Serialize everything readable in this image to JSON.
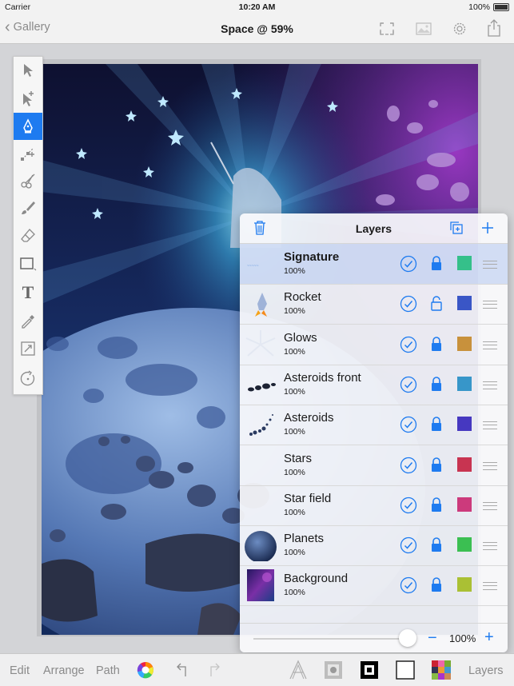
{
  "status": {
    "carrier": "Carrier",
    "time": "10:20 AM",
    "battery": "100%"
  },
  "nav": {
    "back_label": "Gallery",
    "title": "Space @ 59%",
    "icons": [
      "fullscreen-icon",
      "image-icon",
      "gear-icon",
      "share-icon"
    ]
  },
  "tools": [
    "select-arrow-icon",
    "direct-select-icon",
    "pen-icon",
    "node-icon",
    "scissors-icon",
    "brush-icon",
    "eraser-icon",
    "rectangle-icon",
    "text-icon",
    "eyedropper-icon",
    "transform-icon",
    "rotate-icon"
  ],
  "tools_active": "pen-icon",
  "tools_text_glyph": "T",
  "layers": {
    "title": "Layers",
    "items": [
      {
        "name": "Signature",
        "opacity": "100%",
        "locked": true,
        "color": "#35c08a",
        "selected": true
      },
      {
        "name": "Rocket",
        "opacity": "100%",
        "locked": false,
        "color": "#3a56c6",
        "selected": false
      },
      {
        "name": "Glows",
        "opacity": "100%",
        "locked": true,
        "color": "#c8913c",
        "selected": false
      },
      {
        "name": "Asteroids front",
        "opacity": "100%",
        "locked": true,
        "color": "#3796c9",
        "selected": false
      },
      {
        "name": "Asteroids",
        "opacity": "100%",
        "locked": true,
        "color": "#4638c0",
        "selected": false
      },
      {
        "name": "Stars",
        "opacity": "100%",
        "locked": true,
        "color": "#c83451",
        "selected": false
      },
      {
        "name": "Star field",
        "opacity": "100%",
        "locked": true,
        "color": "#cc3a7c",
        "selected": false
      },
      {
        "name": "Planets",
        "opacity": "100%",
        "locked": true,
        "color": "#3bbf52",
        "selected": false
      },
      {
        "name": "Background",
        "opacity": "100%",
        "locked": true,
        "color": "#aac034",
        "selected": false
      }
    ],
    "opacity_value": "100%",
    "minus_label": "−",
    "plus_label": "+"
  },
  "bottombar": {
    "edit_label": "Edit",
    "arrange_label": "Arrange",
    "path_label": "Path",
    "layers_label": "Layers"
  },
  "colors": {
    "accent": "#1e7bf0"
  }
}
